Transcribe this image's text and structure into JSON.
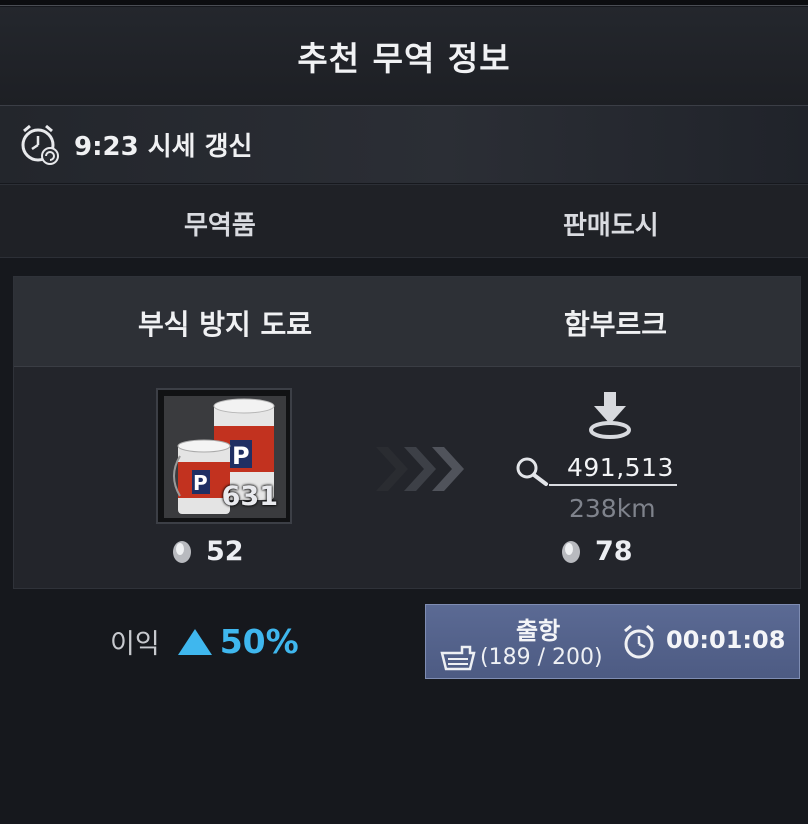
{
  "header": {
    "title": "추천 무역 정보"
  },
  "refresh": {
    "text": "9:23 시세 갱신"
  },
  "columns": {
    "goods": "무역품",
    "city": "판매도시"
  },
  "trade": {
    "item_name": "부식 방지 도료",
    "item_quantity": "631",
    "item_coin": "52",
    "city_name": "함부르크",
    "price": "491,513",
    "distance": "238km",
    "city_coin": "78"
  },
  "profit": {
    "label": "이익",
    "value": "50%"
  },
  "depart": {
    "label": "출항",
    "capacity": "(189 / 200)",
    "timer": "00:01:08"
  },
  "colors": {
    "accent": "#3fb7ee",
    "button": "#55638c"
  }
}
